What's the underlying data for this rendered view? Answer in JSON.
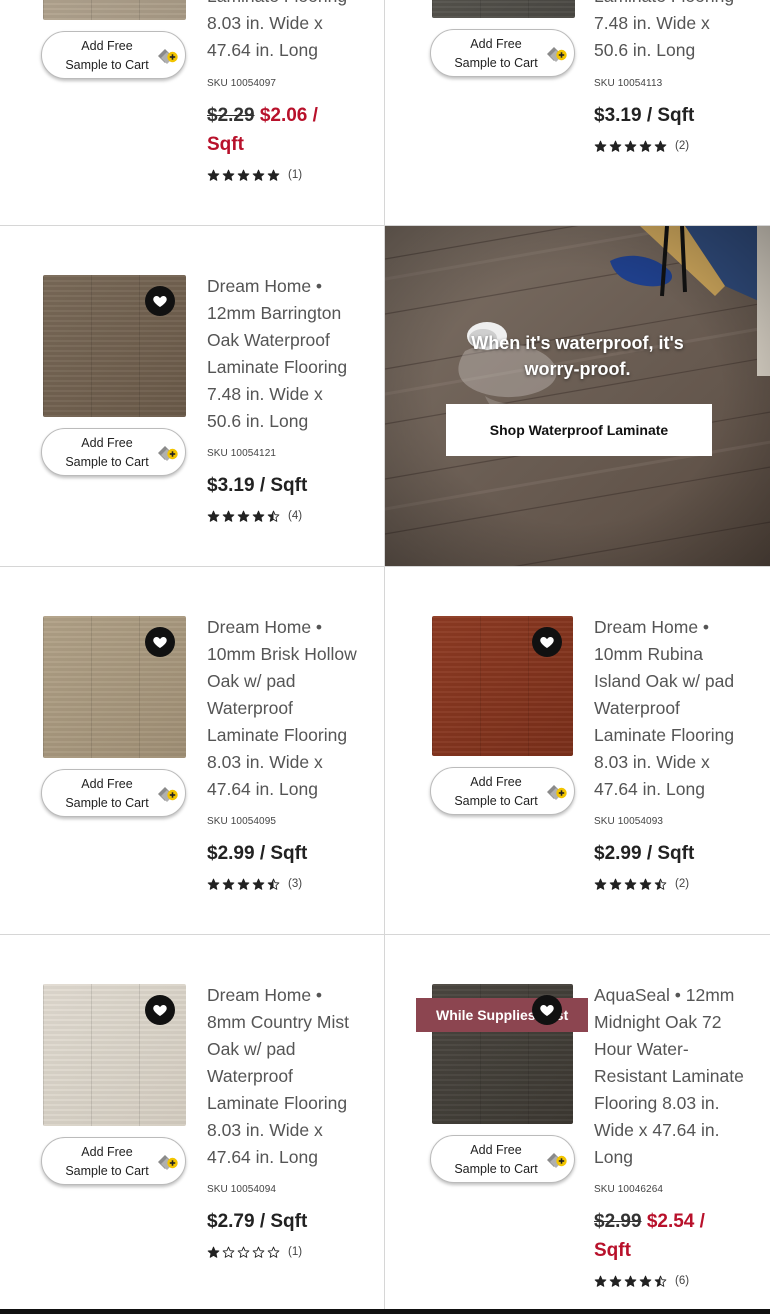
{
  "products": [
    {
      "title": "Laminate Flooring 8.03 in. Wide x 47.64 in. Long",
      "sku": "SKU 10054097",
      "price_old": "$2.29",
      "price": "$2.06 / Sqft",
      "rating": 5,
      "review_count": "(1)",
      "sample_label_1": "Add Free",
      "sample_label_2": "Sample to Cart",
      "swatch": "light-oak"
    },
    {
      "title": "Laminate Flooring 7.48 in. Wide x 50.6 in. Long",
      "sku": "SKU 10054113",
      "price": "$3.19 / Sqft",
      "rating": 5,
      "review_count": "(2)",
      "sample_label_1": "Add Free",
      "sample_label_2": "Sample to Cart",
      "swatch": "grey-oak"
    },
    {
      "title": "Dream Home • 12mm Barrington Oak Waterproof Laminate Flooring 7.48 in. Wide x 50.6 in. Long",
      "sku": "SKU 10054121",
      "price": "$3.19 / Sqft",
      "rating": 4.5,
      "review_count": "(4)",
      "sample_label_1": "Add Free",
      "sample_label_2": "Sample to Cart",
      "swatch": "brown-oak"
    },
    {
      "title": "Dream Home • 10mm Brisk Hollow Oak w/ pad Waterproof Laminate Flooring 8.03 in. Wide x 47.64 in. Long",
      "sku": "SKU 10054095",
      "price": "$2.99 / Sqft",
      "rating": 4.5,
      "review_count": "(3)",
      "sample_label_1": "Add Free",
      "sample_label_2": "Sample to Cart",
      "swatch": "tan-oak"
    },
    {
      "title": "Dream Home • 10mm Rubina Island Oak w/ pad Waterproof Laminate Flooring 8.03 in. Wide x 47.64 in. Long",
      "sku": "SKU 10054093",
      "price": "$2.99 / Sqft",
      "rating": 4.5,
      "review_count": "(2)",
      "sample_label_1": "Add Free",
      "sample_label_2": "Sample to Cart",
      "swatch": "red-oak"
    },
    {
      "title": "Dream Home • 8mm Country Mist Oak w/ pad Waterproof Laminate Flooring 8.03 in. Wide x 47.64 in. Long",
      "sku": "SKU 10054094",
      "price": "$2.79 / Sqft",
      "rating": 1,
      "review_count": "(1)",
      "sample_label_1": "Add Free",
      "sample_label_2": "Sample to Cart",
      "swatch": "mist-oak"
    },
    {
      "title": "AquaSeal • 12mm Midnight Oak 72 Hour Water-Resistant Laminate Flooring 8.03 in. Wide x 47.64 in. Long",
      "sku": "SKU 10046264",
      "price_old": "$2.99",
      "price": "$2.54 / Sqft",
      "rating": 4.5,
      "review_count": "(6)",
      "sample_label_1": "Add Free",
      "sample_label_2": "Sample to Cart",
      "swatch": "midnight-oak",
      "badge": "While Supplies Last"
    }
  ],
  "promo": {
    "headline": "When it's waterproof, it's worry-proof.",
    "button": "Shop Waterproof Laminate"
  },
  "colors": {
    "sale": "#b8112b",
    "badge": "#8c4550",
    "text": "#555555",
    "divider": "#d6d6d6"
  },
  "icons": {
    "favorite": "heart-icon",
    "sample": "sample-swatch-plus-icon",
    "rating": "star-icon"
  }
}
